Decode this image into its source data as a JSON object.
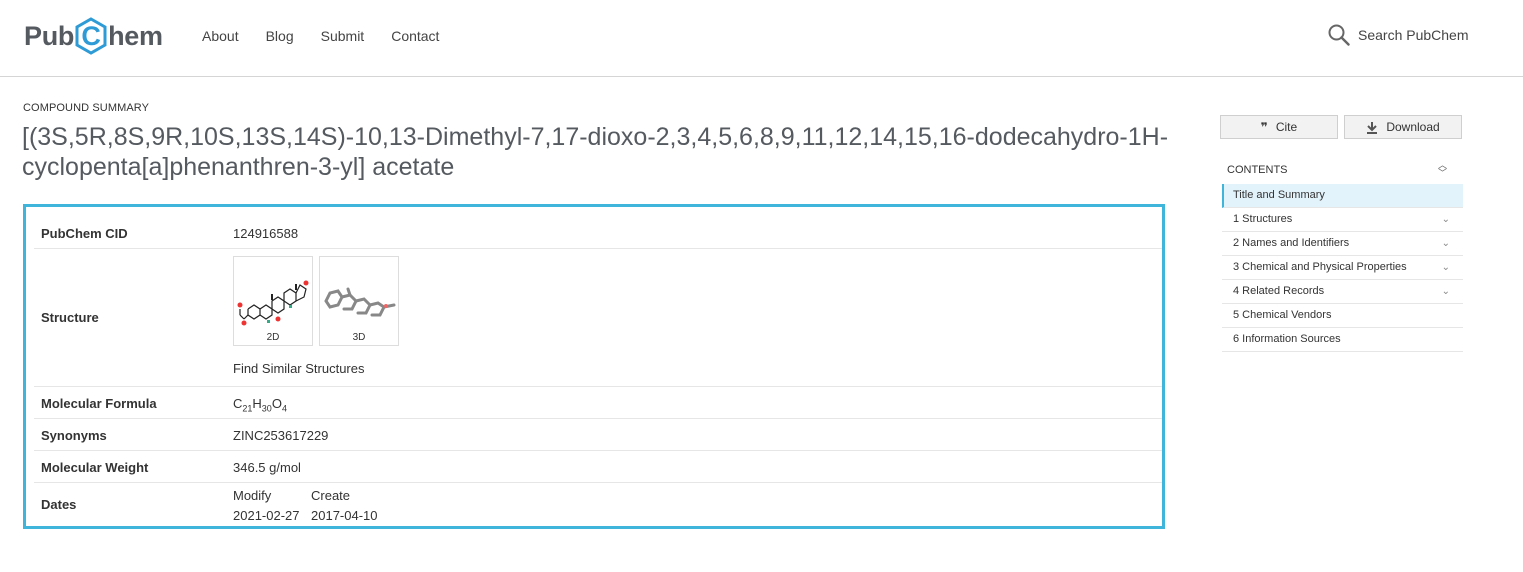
{
  "header": {
    "logo_left": "Pub",
    "logo_mid": "C",
    "logo_right": "hem",
    "nav": [
      "About",
      "Blog",
      "Submit",
      "Contact"
    ],
    "search_label": "Search PubChem"
  },
  "page": {
    "kicker": "COMPOUND SUMMARY",
    "title": "[(3S,5R,8S,9R,10S,13S,14S)-10,13-Dimethyl-7,17-dioxo-2,3,4,5,6,8,9,11,12,14,15,16-dodecahydro-1H-cyclopenta[a]phenanthren-3-yl] acetate"
  },
  "summary": {
    "cid_label": "PubChem CID",
    "cid_value": "124916588",
    "structure_label": "Structure",
    "thumb_2d": "2D",
    "thumb_3d": "3D",
    "find_similar": "Find Similar Structures",
    "formula_label": "Molecular Formula",
    "formula": {
      "c": "C",
      "c_n": "21",
      "h": "H",
      "h_n": "30",
      "o": "O",
      "o_n": "4"
    },
    "synonyms_label": "Synonyms",
    "synonyms_value": "ZINC253617229",
    "weight_label": "Molecular Weight",
    "weight_value": "346.5 g/mol",
    "dates_label": "Dates",
    "modify_label": "Modify",
    "modify_date": "2021-02-27",
    "create_label": "Create",
    "create_date": "2017-04-10"
  },
  "sidebar": {
    "cite": "Cite",
    "download": "Download",
    "contents_label": "CONTENTS",
    "toc": [
      {
        "label": "Title and Summary",
        "active": true,
        "chevron": false
      },
      {
        "label": "1 Structures",
        "active": false,
        "chevron": true
      },
      {
        "label": "2 Names and Identifiers",
        "active": false,
        "chevron": true
      },
      {
        "label": "3 Chemical and Physical Properties",
        "active": false,
        "chevron": true
      },
      {
        "label": "4 Related Records",
        "active": false,
        "chevron": true
      },
      {
        "label": "5 Chemical Vendors",
        "active": false,
        "chevron": false
      },
      {
        "label": "6 Information Sources",
        "active": false,
        "chevron": false
      }
    ]
  },
  "colors": {
    "accent": "#3fb5dc",
    "link": "#1d5fa0",
    "logo_gray": "#555a60",
    "toc_active_bg": "#e3f3fb"
  },
  "icons": [
    "pubchem-hexagon-icon",
    "search-icon",
    "quote-icon",
    "download-icon",
    "chevron-down-icon",
    "sort-arrows-icon"
  ]
}
